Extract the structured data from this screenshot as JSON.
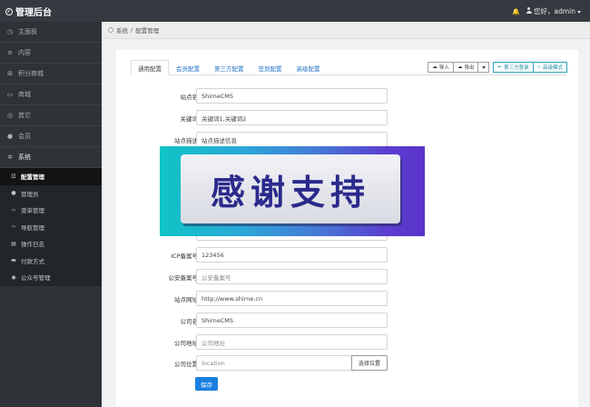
{
  "header": {
    "app_title": "管理后台",
    "greeting": "您好，admin"
  },
  "sidebar": {
    "items": [
      {
        "label": "主面板",
        "icon": "gauge-icon"
      },
      {
        "label": "内容",
        "icon": "list-icon"
      },
      {
        "label": "积分商城",
        "icon": "cart-icon"
      },
      {
        "label": "商城",
        "icon": "shop-icon"
      },
      {
        "label": "其它",
        "icon": "circle-icon"
      },
      {
        "label": "会员",
        "icon": "user-icon"
      },
      {
        "label": "系统",
        "icon": "cog-icon"
      }
    ],
    "subitems": [
      {
        "label": "配置管理",
        "icon": "sliders-icon",
        "active": true
      },
      {
        "label": "管理员",
        "icon": "user-icon"
      },
      {
        "label": "菜单管理",
        "icon": "code-icon"
      },
      {
        "label": "导航管理",
        "icon": "code-icon"
      },
      {
        "label": "操作日志",
        "icon": "file-icon"
      },
      {
        "label": "付款方式",
        "icon": "card-icon"
      },
      {
        "label": "公众号管理",
        "icon": "chat-icon"
      }
    ]
  },
  "breadcrumb": {
    "root": "系统",
    "sep": "/",
    "current": "配置管理"
  },
  "tabs": [
    "通用配置",
    "会员配置",
    "第三方配置",
    "签到配置",
    "高级配置"
  ],
  "toolbar": {
    "import": "导入",
    "export": "导出",
    "third_login": "第三方登录",
    "advanced": "高级模式"
  },
  "form": {
    "site_name": {
      "label": "站点名",
      "value": "ShirneCMS"
    },
    "keywords": {
      "label": "关键词",
      "value": "关键词1,关键词2"
    },
    "description": {
      "label": "站点描述",
      "value": "站点描述信息"
    },
    "icp": {
      "label": "ICP备案号",
      "value": "123456"
    },
    "police": {
      "label": "公安备案号",
      "placeholder": "公安备案号"
    },
    "url": {
      "label": "站点网址",
      "value": "http://www.shirne.cn"
    },
    "company": {
      "label": "公司名",
      "value": "ShirneCMS"
    },
    "address": {
      "label": "公司地址",
      "placeholder": "公司地址"
    },
    "location": {
      "label": "公司位置",
      "placeholder": "location",
      "button": "选择位置"
    },
    "save": "保存"
  },
  "overlay": {
    "text": "感谢支持"
  },
  "colors": {
    "topbar": "#343a40",
    "sidebar": "#2e3338",
    "primary": "#1a7fe0",
    "teal": "#29a3b4"
  }
}
